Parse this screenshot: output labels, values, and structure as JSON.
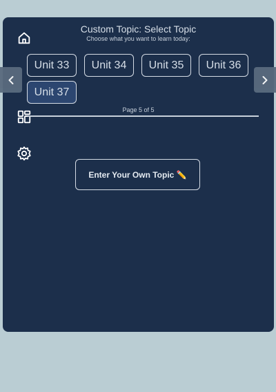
{
  "header": {
    "title": "Custom Topic: Select Topic",
    "subtitle": "Choose what you want to learn today:"
  },
  "units": [
    {
      "label": "Unit 33",
      "selected": false
    },
    {
      "label": "Unit 34",
      "selected": false
    },
    {
      "label": "Unit 35",
      "selected": false
    },
    {
      "label": "Unit 36",
      "selected": false
    },
    {
      "label": "Unit 37",
      "selected": true
    }
  ],
  "pagination": {
    "label": "Page 5 of 5",
    "current": 5,
    "total": 5
  },
  "actions": {
    "own_topic_label": "Enter Your Own Topic ✏️"
  },
  "icons": {
    "home": "home-icon",
    "dashboard": "dashboard-icon",
    "settings": "gear-icon",
    "prev": "chevron-left-icon",
    "next": "chevron-right-icon"
  },
  "colors": {
    "background": "#bacdd3",
    "panel": "#1c2f4b",
    "selected_unit": "#2c4670",
    "text": "#d7dfe8",
    "nav_arrow": "#5a6b7e"
  }
}
